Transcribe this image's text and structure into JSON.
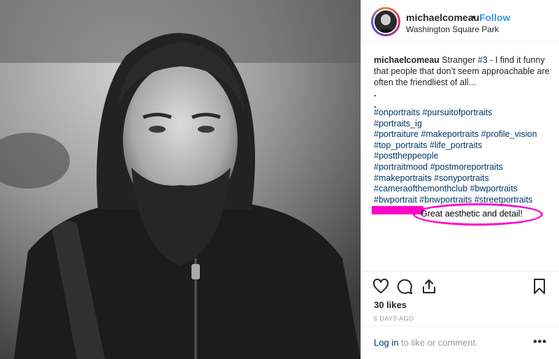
{
  "post": {
    "username": "michaelcomeau",
    "separator": "•",
    "follow_label": "Follow",
    "location": "Washington Square Park",
    "image_alt": "Black and white portrait of a bearded man in a hooded sweatshirt"
  },
  "caption": {
    "username": "michaelcomeau",
    "text_before": " Stranger ",
    "number_tag": "#3",
    "text_after": " - I find it funny that people that don’t seem approachable are often the friendliest of all...",
    "dot1": ".",
    "dot2": ".",
    "hashtag_lines": [
      "#onportraits #pursuitofportraits",
      "#portraits_ig",
      "#portraiture #makeportraits #profile_vision",
      "#top_portraits #life_portraits",
      "#posttheppeople",
      "#portraitmood #postmoreportraits",
      "#makeportraits #sonyportraits",
      "#cameraofthemonthclub #bwportraits",
      "#bwportrait #bnwportraits #streetportraits"
    ]
  },
  "annotation": {
    "comment": "Great aesthetic and detail!",
    "highlight_color": "#ff00cc"
  },
  "actions": {
    "like_icon": "heart-icon",
    "comment_icon": "comment-bubble-icon",
    "share_icon": "share-upload-icon",
    "save_icon": "bookmark-icon"
  },
  "stats": {
    "likes": "30 likes",
    "age": "6 DAYS AGO"
  },
  "footer": {
    "login_label": "Log in",
    "login_suffix": " to like or comment.",
    "more_label": "•••"
  },
  "colors": {
    "link_blue": "#3897f0",
    "hashtag_navy": "#003569",
    "text": "#262626",
    "muted": "#999999"
  }
}
